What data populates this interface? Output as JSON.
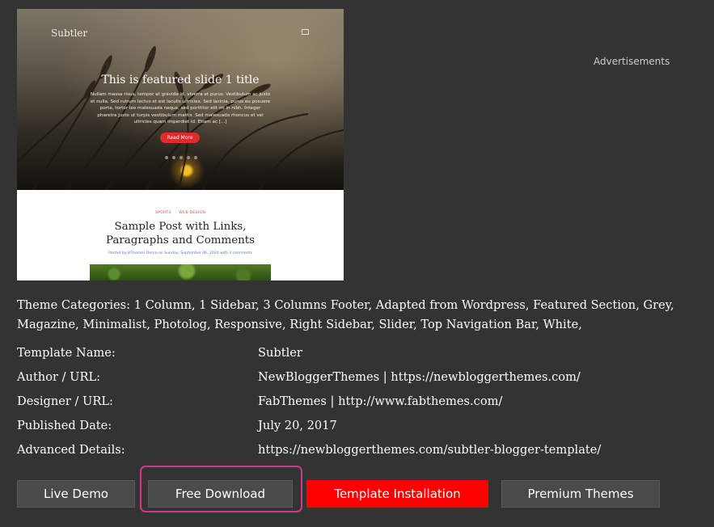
{
  "preview": {
    "brand": "Subtler",
    "slide_title": "This is featured slide 1 title",
    "slide_text": "Nullam massa risus, tempor at gravida id, viverra et purus. Vestibulum ac justo et nulla. Sed rutrum lectus et est iaculis ultricies. Sed lacinia, purus eu posuere porta, tortor leo malesuada neque, sed porttitor elit mi in nibh. Integer pharetra justo ut turpis vestibulum mattis. Sed malesuada rhoncus et vel ultricies quam imperdiet id. Etiam ac [...]",
    "read_more": "Read More",
    "post_tags": [
      "SPORTS",
      "WEB DESIGN"
    ],
    "post_title": "Sample Post with Links, Paragraphs and Comments",
    "post_meta": "Posted by BThemes Demo on Sunday, September 06, 2020 with 3 comments"
  },
  "advertisements_label": "Advertisements",
  "theme_categories": "Theme Categories: 1 Column, 1 Sidebar, 3 Columns Footer, Adapted from Wordpress, Featured Section, Grey, Magazine, Minimalist, Photolog, Responsive, Right Sidebar, Slider, Top Navigation Bar, White,",
  "details": [
    {
      "label": "Template Name:",
      "value": "Subtler"
    },
    {
      "label": "Author / URL:",
      "value": "NewBloggerThemes | https://newbloggerthemes.com/"
    },
    {
      "label": "Designer / URL:",
      "value": "FabThemes | http://www.fabthemes.com/"
    },
    {
      "label": "Published Date:",
      "value": "July 20, 2017"
    },
    {
      "label": "Advanced Details:",
      "value": "https://newbloggerthemes.com/subtler-blogger-template/"
    }
  ],
  "buttons": {
    "live_demo": "Live Demo",
    "free_download": "Free Download",
    "template_installation": "Template Installation",
    "premium_themes": "Premium Themes"
  },
  "colors": {
    "page_background": "#333333",
    "button_dark": "#4a4a4a",
    "button_accent": "#ff0000",
    "focus_ring": "#d63586"
  }
}
